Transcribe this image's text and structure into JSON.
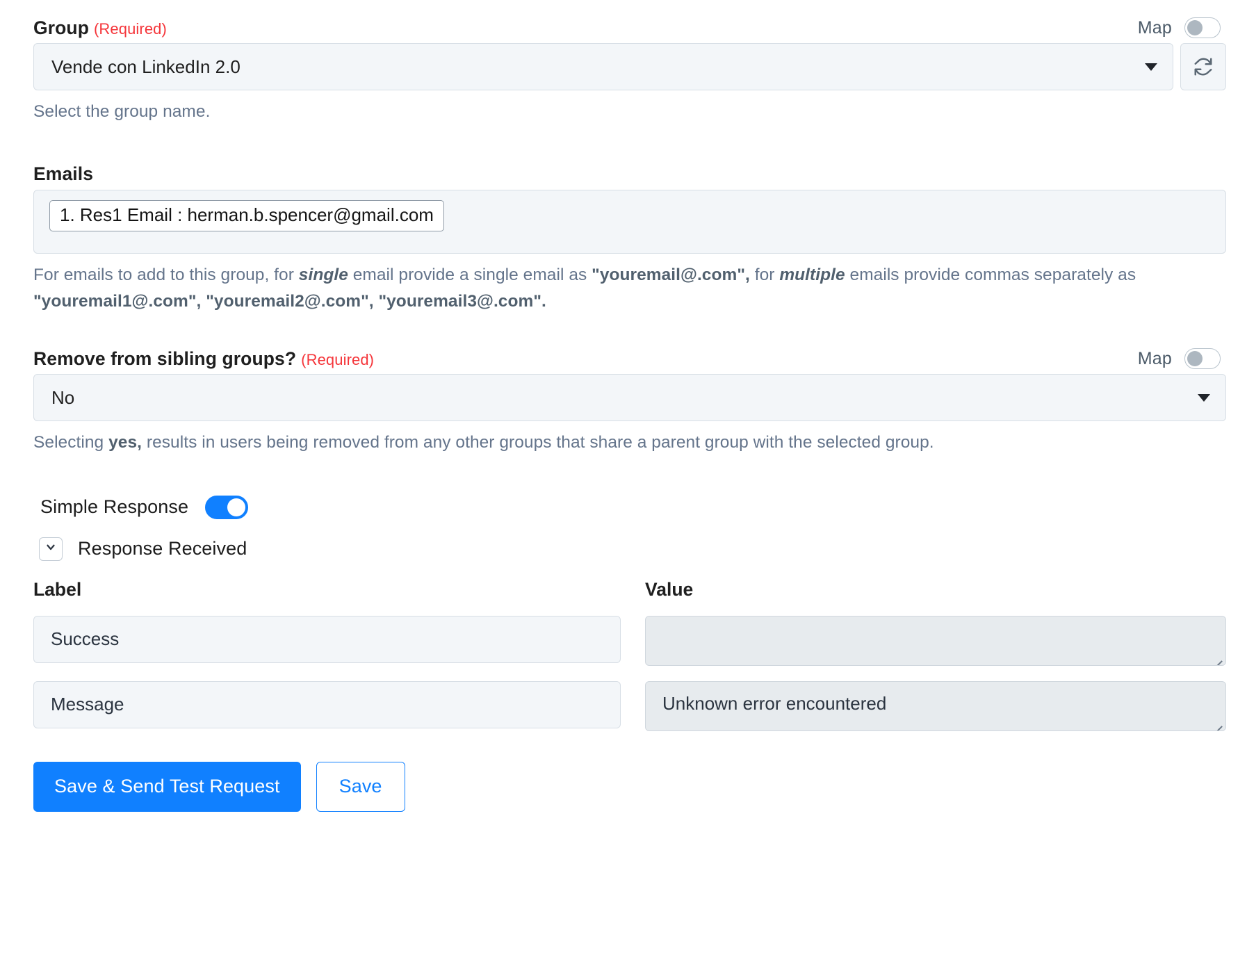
{
  "group_field": {
    "label": "Group",
    "required_text": "(Required)",
    "map_label": "Map",
    "map_enabled": false,
    "selected_value": "Vende con LinkedIn 2.0",
    "helper": "Select the group name.",
    "refresh_icon": "refresh-icon",
    "caret_icon": "chevron-down-icon"
  },
  "emails_field": {
    "label": "Emails",
    "tokens": [
      "1. Res1 Email : herman.b.spencer@gmail.com"
    ],
    "helper": {
      "p1": "For emails to add to this group, for ",
      "em1": "single",
      "p2": " email provide a single email as ",
      "b1": "\"youremail@.com\",",
      "p3": " for ",
      "em2": "multiple",
      "p4": " emails provide commas separately as ",
      "b2": "\"youremail1@.com\", \"youremail2@.com\", \"youremail3@.com\"."
    }
  },
  "sibling_field": {
    "label": "Remove from sibling groups?",
    "required_text": "(Required)",
    "map_label": "Map",
    "map_enabled": false,
    "selected_value": "No",
    "helper": {
      "p1": "Selecting ",
      "b1": "yes,",
      "p2": " results in users being removed from any other groups that share a parent group with the selected group."
    }
  },
  "simple_response": {
    "label": "Simple Response",
    "enabled": true
  },
  "response_section": {
    "title": "Response Received",
    "chevron_icon": "chevron-down-icon",
    "columns": {
      "label": "Label",
      "value": "Value"
    },
    "rows": [
      {
        "label": "Success",
        "value": ""
      },
      {
        "label": "Message",
        "value": "Unknown error encountered"
      }
    ]
  },
  "actions": {
    "primary": "Save & Send Test Request",
    "secondary": "Save"
  },
  "colors": {
    "accent": "#1080ff",
    "required": "#f5353a",
    "input_bg": "#f3f6f9",
    "textarea_bg": "#e7ebee",
    "helper_text": "#64748b"
  }
}
